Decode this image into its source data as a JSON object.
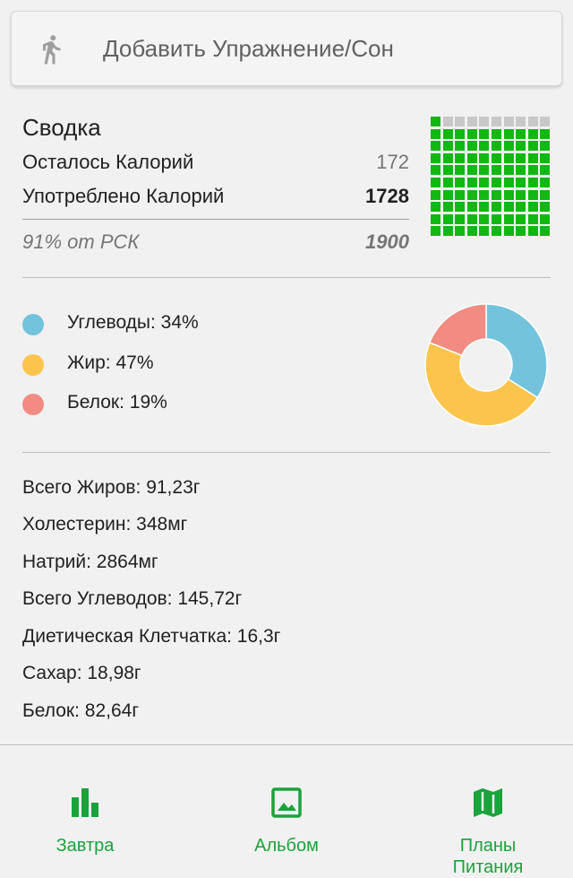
{
  "add_bar": {
    "label": "Добавить Упражнение/Сон",
    "icon": "runner-icon"
  },
  "summary": {
    "title": "Сводка",
    "remaining_label": "Осталось Калорий",
    "remaining_value": "172",
    "consumed_label": "Употреблено Калорий",
    "consumed_value": "1728",
    "rsk_label": "91% от РСК",
    "rsk_value": "1900",
    "grid_filled_fraction": 0.91,
    "grid_color_filled": "#11b811",
    "grid_color_empty": "#c8c8c8"
  },
  "macros": {
    "items": [
      {
        "label": "Углеводы: 34%",
        "percent": 34,
        "color": "#74c3dc"
      },
      {
        "label": "Жир: 47%",
        "percent": 47,
        "color": "#fbc54d"
      },
      {
        "label": "Белок: 19%",
        "percent": 19,
        "color": "#f28b82"
      }
    ]
  },
  "nutrients": [
    "Всего Жиров: 91,23г",
    "Холестерин: 348мг",
    "Натрий: 2864мг",
    "Всего Углеводов: 145,72г",
    "Диетическая Клетчатка: 16,3г",
    "Сахар: 18,98г",
    "Белок: 82,64г"
  ],
  "nav": {
    "accent": "#1aa33b",
    "items": [
      {
        "label": "Завтра",
        "icon": "bar-chart-icon"
      },
      {
        "label": "Альбом",
        "icon": "image-icon"
      },
      {
        "label": "Планы\nПитания",
        "icon": "map-icon"
      }
    ]
  }
}
